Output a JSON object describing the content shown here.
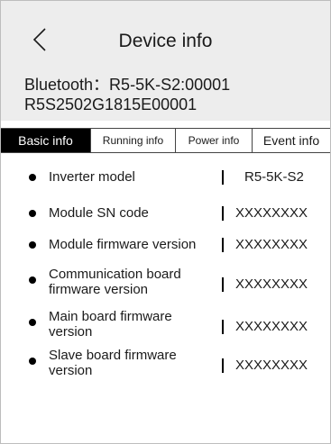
{
  "header": {
    "title": "Device info",
    "back_icon": "chevron-left-icon",
    "bluetooth": "Bluetooth：R5-5K-S2:00001",
    "serial": "R5S2502G1815E00001",
    "background": "#ededed"
  },
  "tabs": [
    {
      "label": "Basic info",
      "active": true
    },
    {
      "label": "Running info",
      "active": false
    },
    {
      "label": "Power info",
      "active": false
    },
    {
      "label": "Event info",
      "active": false
    }
  ],
  "rows": [
    {
      "label_1": "Inverter model",
      "label_2": "",
      "value": "R5-5K-S2"
    },
    {
      "label_1": "Module SN code",
      "label_2": "",
      "value": "XXXXXXXX"
    },
    {
      "label_1": "Module firmware version",
      "label_2": "",
      "value": "XXXXXXXX"
    },
    {
      "label_1": "Communication board",
      "label_2": "firmware version",
      "value": "XXXXXXXX"
    },
    {
      "label_1": "Main board firmware",
      "label_2": "version",
      "value": "XXXXXXXX"
    },
    {
      "label_1": "Slave board firmware",
      "label_2": "version",
      "value": "XXXXXXXX"
    }
  ]
}
